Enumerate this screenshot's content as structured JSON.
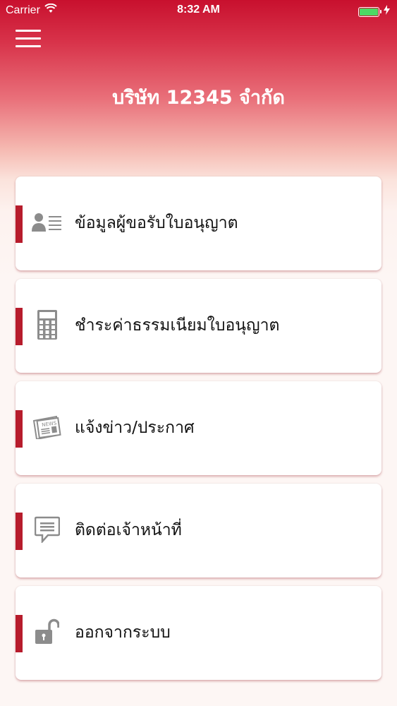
{
  "status_bar": {
    "carrier": "Carrier",
    "time": "8:32 AM"
  },
  "header": {
    "title": "บริษัท 12345 จำกัด",
    "menu_icon": "hamburger-menu-icon"
  },
  "menu": {
    "items": [
      {
        "label": "ข้อมูลผู้ขอรับใบอนุญาต",
        "icon": "user-profile-icon"
      },
      {
        "label": "ชำระค่าธรรมเนียมใบอนุญาต",
        "icon": "calculator-icon"
      },
      {
        "label": "แจ้งข่าว/ประกาศ",
        "icon": "newspaper-icon"
      },
      {
        "label": "ติดต่อเจ้าหน้าที่",
        "icon": "chat-bubble-icon"
      },
      {
        "label": "ออกจากระบบ",
        "icon": "unlock-icon"
      }
    ]
  },
  "colors": {
    "brand": "#c8102e",
    "accent_bar": "#b71c2c",
    "icon": "#8c8c8c",
    "battery": "#4cd964"
  }
}
